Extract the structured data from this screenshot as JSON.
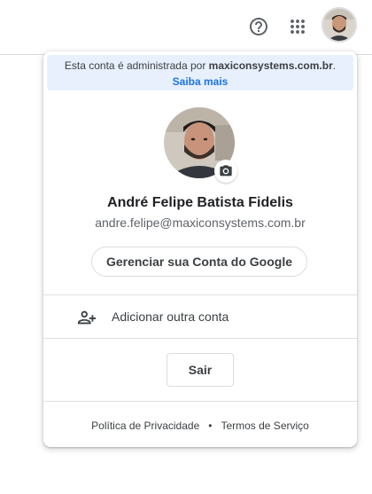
{
  "topbar": {
    "help_icon": "help-circle-icon",
    "apps_icon": "apps-grid-icon"
  },
  "account_menu": {
    "managed_notice_prefix": "Esta conta é administrada por ",
    "managed_domain": "maxiconsystems.com.br",
    "managed_notice_suffix": ".",
    "learn_more": "Saiba mais",
    "user_name": "André Felipe Batista Fidelis",
    "user_email": "andre.felipe@maxiconsystems.com.br",
    "manage_account_label": "Gerenciar sua Conta do Google",
    "add_account_label": "Adicionar outra conta",
    "sign_out_label": "Sair",
    "privacy_label": "Política de Privacidade",
    "separator": "•",
    "terms_label": "Termos de Serviço"
  },
  "colors": {
    "accent": "#1a73e8",
    "managed_bg": "#e8f0fe",
    "border": "#dadce0"
  }
}
